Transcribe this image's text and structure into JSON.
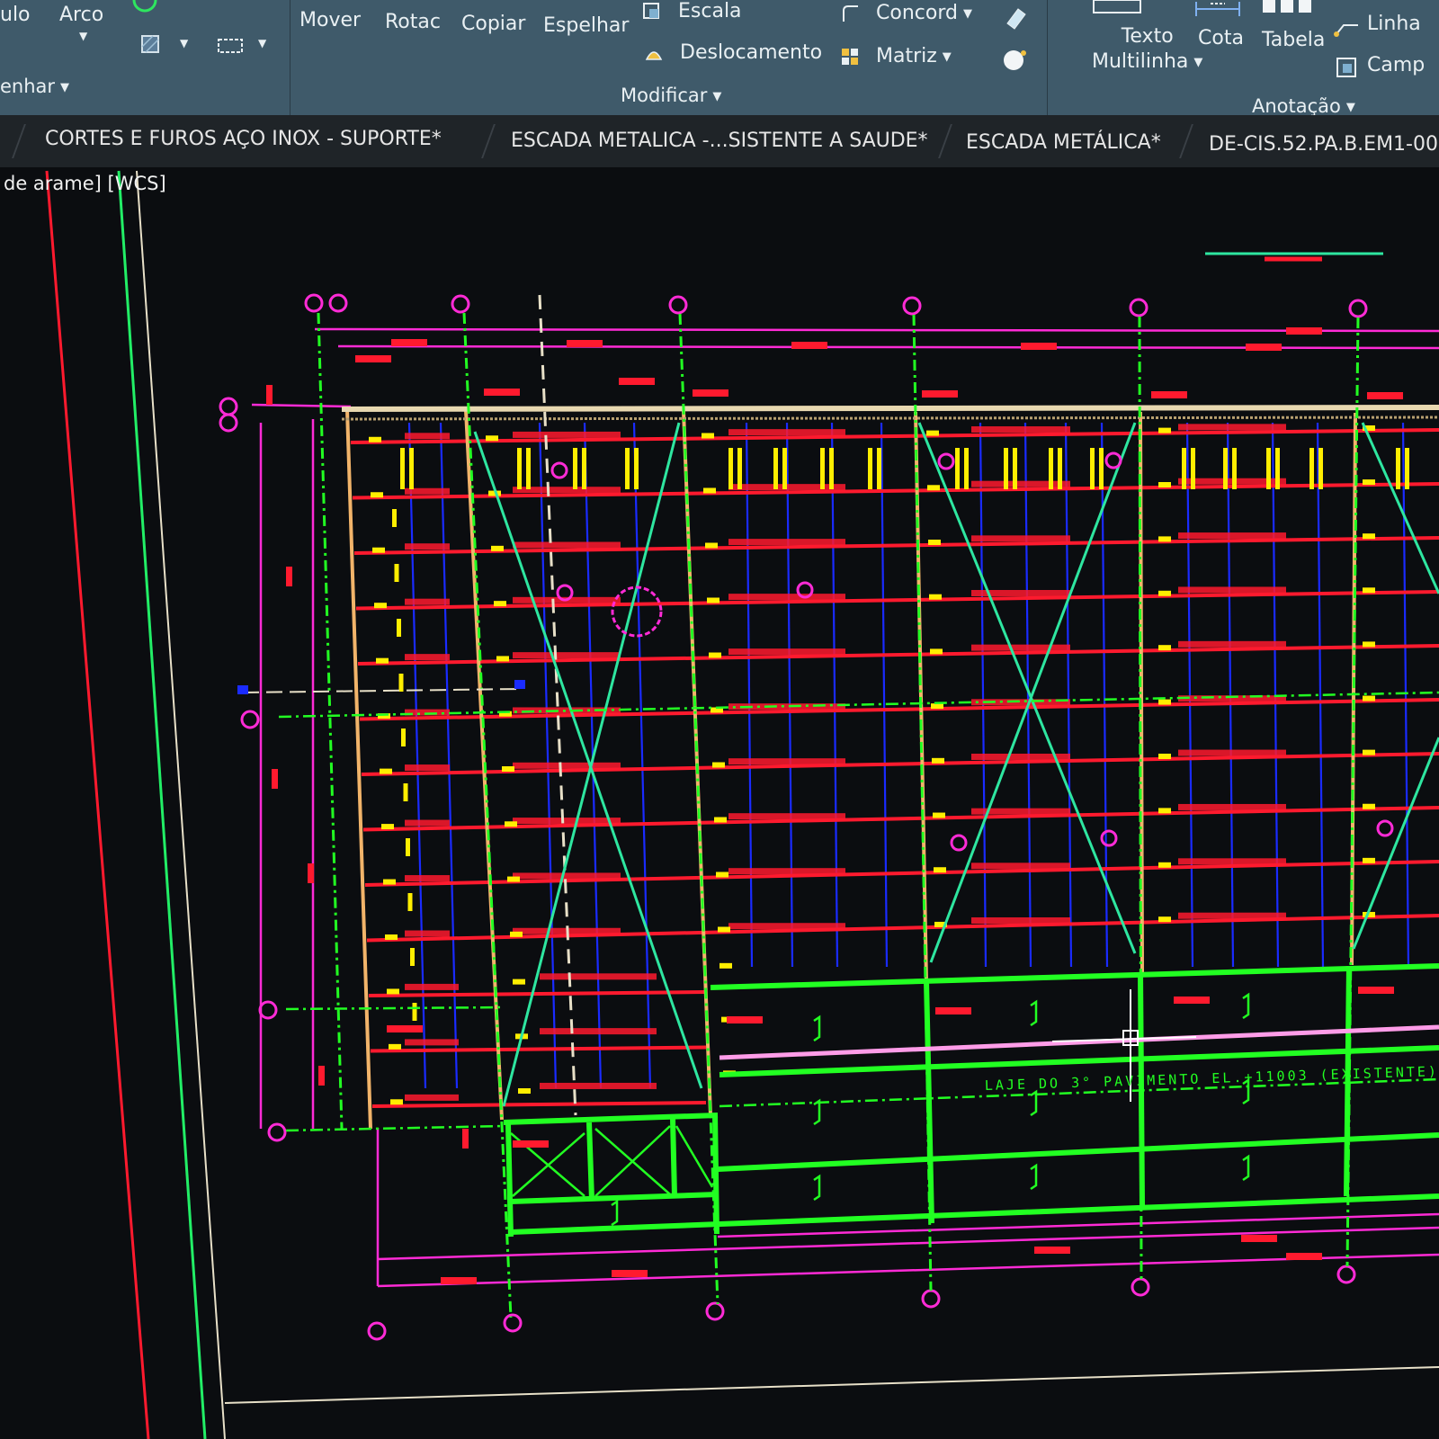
{
  "ribbon": {
    "draw_panel": {
      "partial_label_1": "ulo",
      "arco_label": "Arco",
      "panel_title": "enhar"
    },
    "modify_panel": {
      "mover_label": "Mover",
      "rotac_label": "Rotac",
      "copiar_label": "Copiar",
      "espelhar_label": "Espelhar",
      "escala_label": "Escala",
      "deslocamento_label": "Deslocamento",
      "concord_label": "Concord",
      "matriz_label": "Matriz",
      "panel_title": "Modificar"
    },
    "annotation_panel": {
      "texto_label_1": "Texto",
      "texto_label_2": "Multilinha",
      "cota_label": "Cota",
      "tabela_label": "Tabela",
      "linha_label": "Linha",
      "camp_label": "Camp",
      "panel_title": "Anotação"
    }
  },
  "file_tabs": [
    {
      "label": "CORTES E FUROS AÇO INOX - SUPORTE*"
    },
    {
      "label": "ESCADA METALICA -...SISTENTE A SAUDE*"
    },
    {
      "label": "ESCADA METÁLICA*"
    },
    {
      "label": "DE-CIS.52.PA.B.EM1-00"
    }
  ],
  "viewport": {
    "label": "de arame] [WCS]",
    "drawing_annotation": "LAJE DO 3° PAVIMENTO EL.+11003 (EXISTENTE)"
  },
  "colors": {
    "ribbon_bg": "#3f5a6a",
    "tabs_bg": "#1f2428",
    "canvas_bg": "#0b0d10",
    "beam_red": "#ff1a2e",
    "grid_magenta": "#ff2bd6",
    "column_green": "#22ff22",
    "brace_teal": "#2ee6a0",
    "purlin_blue": "#1a2bff",
    "tag_yellow": "#ffee00"
  }
}
